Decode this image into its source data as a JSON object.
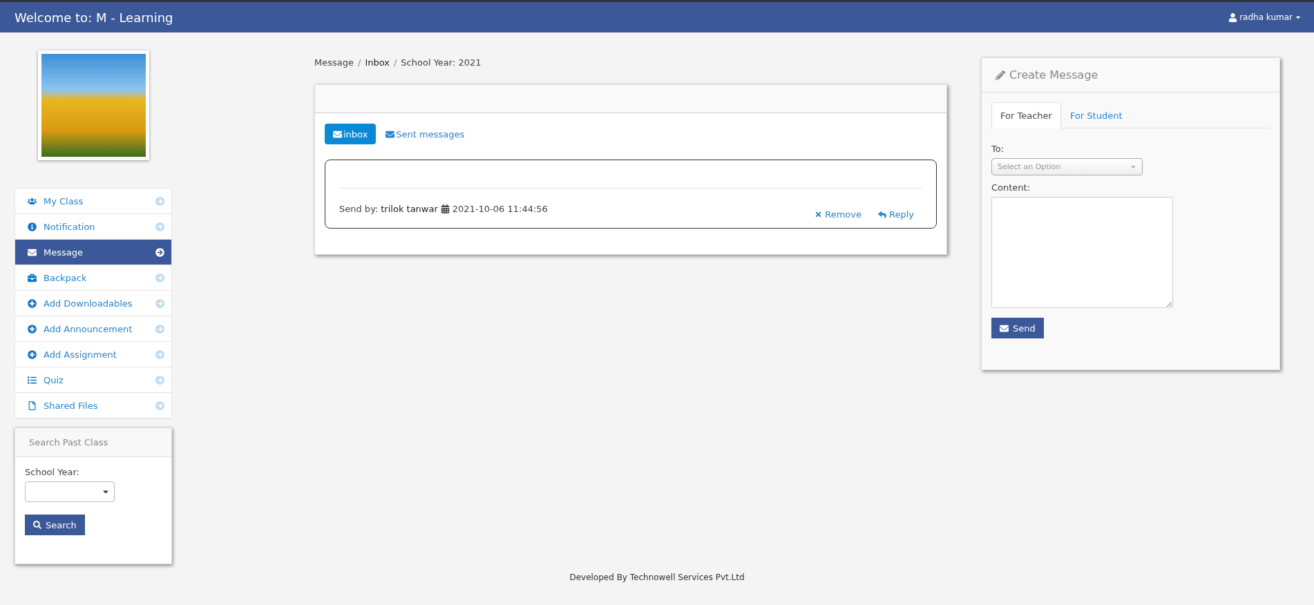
{
  "header": {
    "title": "Welcome to: M - Learning",
    "user": "radha kumar"
  },
  "sidebar": {
    "items": [
      {
        "label": "My Class",
        "selected": false
      },
      {
        "label": "Notification",
        "selected": false
      },
      {
        "label": "Message",
        "selected": true
      },
      {
        "label": "Backpack",
        "selected": false
      },
      {
        "label": "Add Downloadables",
        "selected": false
      },
      {
        "label": "Add Announcement",
        "selected": false
      },
      {
        "label": "Add Assignment",
        "selected": false
      },
      {
        "label": "Quiz",
        "selected": false
      },
      {
        "label": "Shared Files",
        "selected": false
      }
    ],
    "search_panel": {
      "title": "Search Past Class",
      "label": "School Year:",
      "button": "Search"
    }
  },
  "breadcrumb": {
    "separator": "/",
    "items": [
      "Message",
      "Inbox",
      "School Year: 2021"
    ]
  },
  "mailbox": {
    "tabs": [
      {
        "label": "inbox",
        "selected": true
      },
      {
        "label": "Sent messages",
        "selected": false
      }
    ],
    "messages": [
      {
        "sender_label": "Send by:",
        "sender": "trilok tanwar",
        "date": "2021-10-06 11:44:56",
        "remove": "Remove",
        "reply": "Reply"
      }
    ]
  },
  "compose": {
    "title": "Create Message",
    "tabs": [
      {
        "label": "For Teacher",
        "selected": true
      },
      {
        "label": "For Student",
        "selected": false
      }
    ],
    "to_label": "To:",
    "to_placeholder": "Select an Option",
    "content_label": "Content:",
    "send": "Send"
  },
  "footer": "Developed By Technowell Services Pvt.Ltd"
}
